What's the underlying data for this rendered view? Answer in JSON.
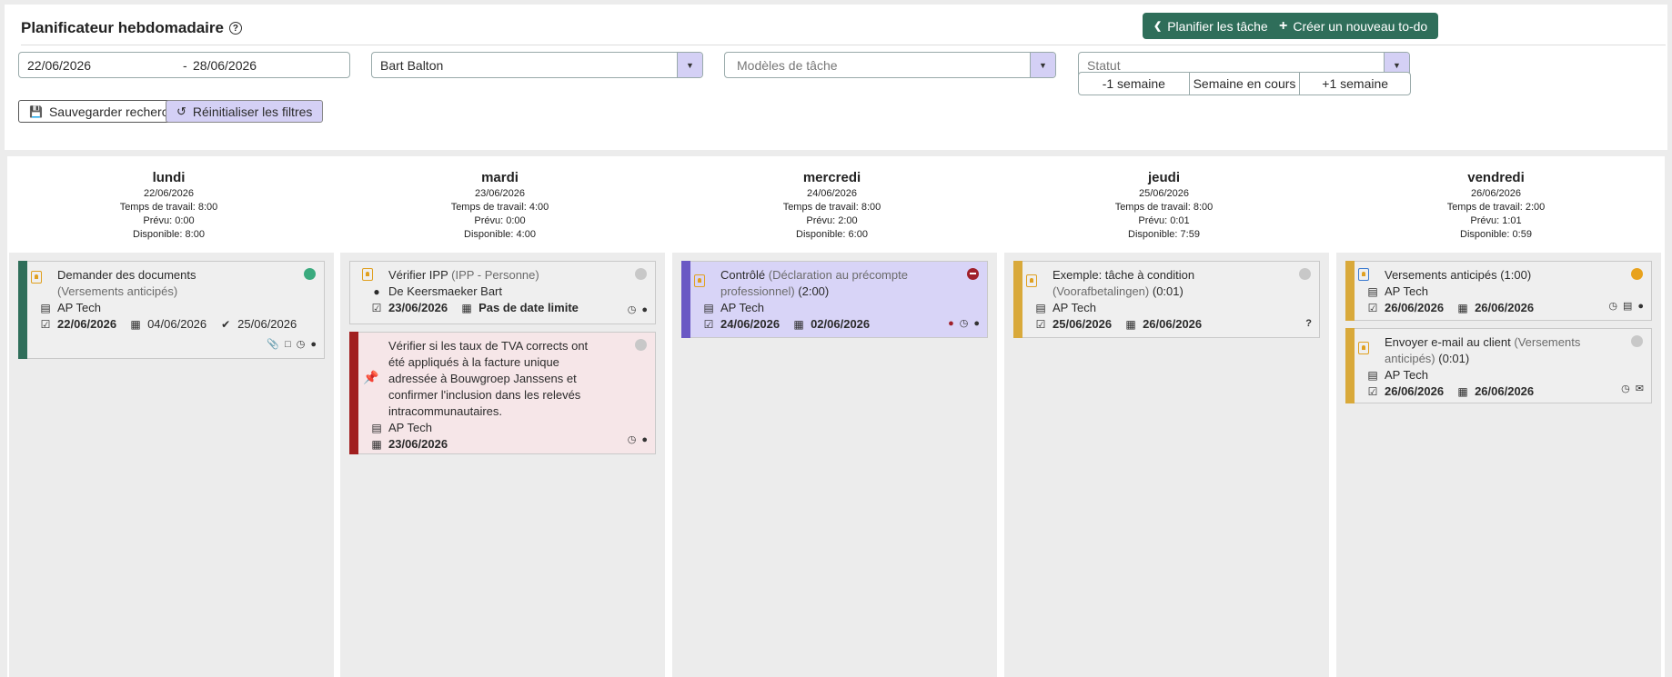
{
  "header": {
    "title": "Planificateur hebdomadaire",
    "help_icon": "?",
    "plan_button": "Planifier les tâches",
    "create_button": "Créer un nouveau to-do"
  },
  "filters": {
    "date_from": "22/06/2026",
    "date_sep": "-",
    "date_to": "28/06/2026",
    "user": "Bart Balton",
    "templates_placeholder": "Modèles de tâche",
    "status_placeholder": "Statut",
    "week_prev": "-1 semaine",
    "week_current": "Semaine en cours",
    "week_next": "+1 semaine",
    "save_search": "Sauvegarder recherche",
    "reset_filters": "Réinitialiser les filtres"
  },
  "colors": {
    "green": "#2f6e5a",
    "lilac": "#d4d0f5",
    "darkred": "#a11f1f",
    "purple": "#6a58c4",
    "yellow": "#d9a93a",
    "teal": "#3aaa7e",
    "amber": "#e8a21c",
    "grey": "#c8c8c8",
    "red": "#a0202a"
  },
  "days": [
    {
      "name": "lundi",
      "date": "22/06/2026",
      "work": "Temps de travail: 8:00",
      "planned": "Prévu: 0:00",
      "available": "Disponible: 8:00"
    },
    {
      "name": "mardi",
      "date": "23/06/2026",
      "work": "Temps de travail: 4:00",
      "planned": "Prévu: 0:00",
      "available": "Disponible: 4:00"
    },
    {
      "name": "mercredi",
      "date": "24/06/2026",
      "work": "Temps de travail: 8:00",
      "planned": "Prévu: 2:00",
      "available": "Disponible: 6:00"
    },
    {
      "name": "jeudi",
      "date": "25/06/2026",
      "work": "Temps de travail: 8:00",
      "planned": "Prévu: 0:01",
      "available": "Disponible: 7:59"
    },
    {
      "name": "vendredi",
      "date": "26/06/2026",
      "work": "Temps de travail: 2:00",
      "planned": "Prévu: 1:01",
      "available": "Disponible: 0:59"
    }
  ],
  "cards": {
    "mon1": {
      "title": "Demander des documents",
      "subtitle": "(Versements anticipés)",
      "client": "AP Tech",
      "date1": "22/06/2026",
      "date2": "04/06/2026",
      "date3": "25/06/2026"
    },
    "tue1": {
      "title": "Vérifier IPP",
      "subtitle": "(IPP - Personne)",
      "person": "De Keersmaeker Bart",
      "date1": "23/06/2026",
      "date2": "Pas de date limite"
    },
    "tue2": {
      "title": "Vérifier si les taux de TVA corrects ont été appliqués à la facture unique adressée à Bouwgroep Janssens et confirmer l'inclusion dans les relevés intracommunautaires.",
      "client": "AP Tech",
      "date1": "23/06/2026"
    },
    "wed1": {
      "title": "Contrôlé",
      "subtitle": "(Déclaration au précompte professionnel)",
      "duration": "(2:00)",
      "client": "AP Tech",
      "date1": "24/06/2026",
      "date2": "02/06/2026"
    },
    "thu1": {
      "title": "Exemple: tâche à condition",
      "subtitle": "(Voorafbetalingen)",
      "duration": "(0:01)",
      "client": "AP Tech",
      "date1": "25/06/2026",
      "date2": "26/06/2026",
      "flag": "?"
    },
    "fri1": {
      "title": "Versements anticipés",
      "duration": "(1:00)",
      "client": "AP Tech",
      "date1": "26/06/2026",
      "date2": "26/06/2026"
    },
    "fri2": {
      "title": "Envoyer e-mail au client",
      "subtitle": "(Versements anticipés)",
      "duration": "(0:01)",
      "client": "AP Tech",
      "date1": "26/06/2026",
      "date2": "26/06/2026"
    }
  }
}
